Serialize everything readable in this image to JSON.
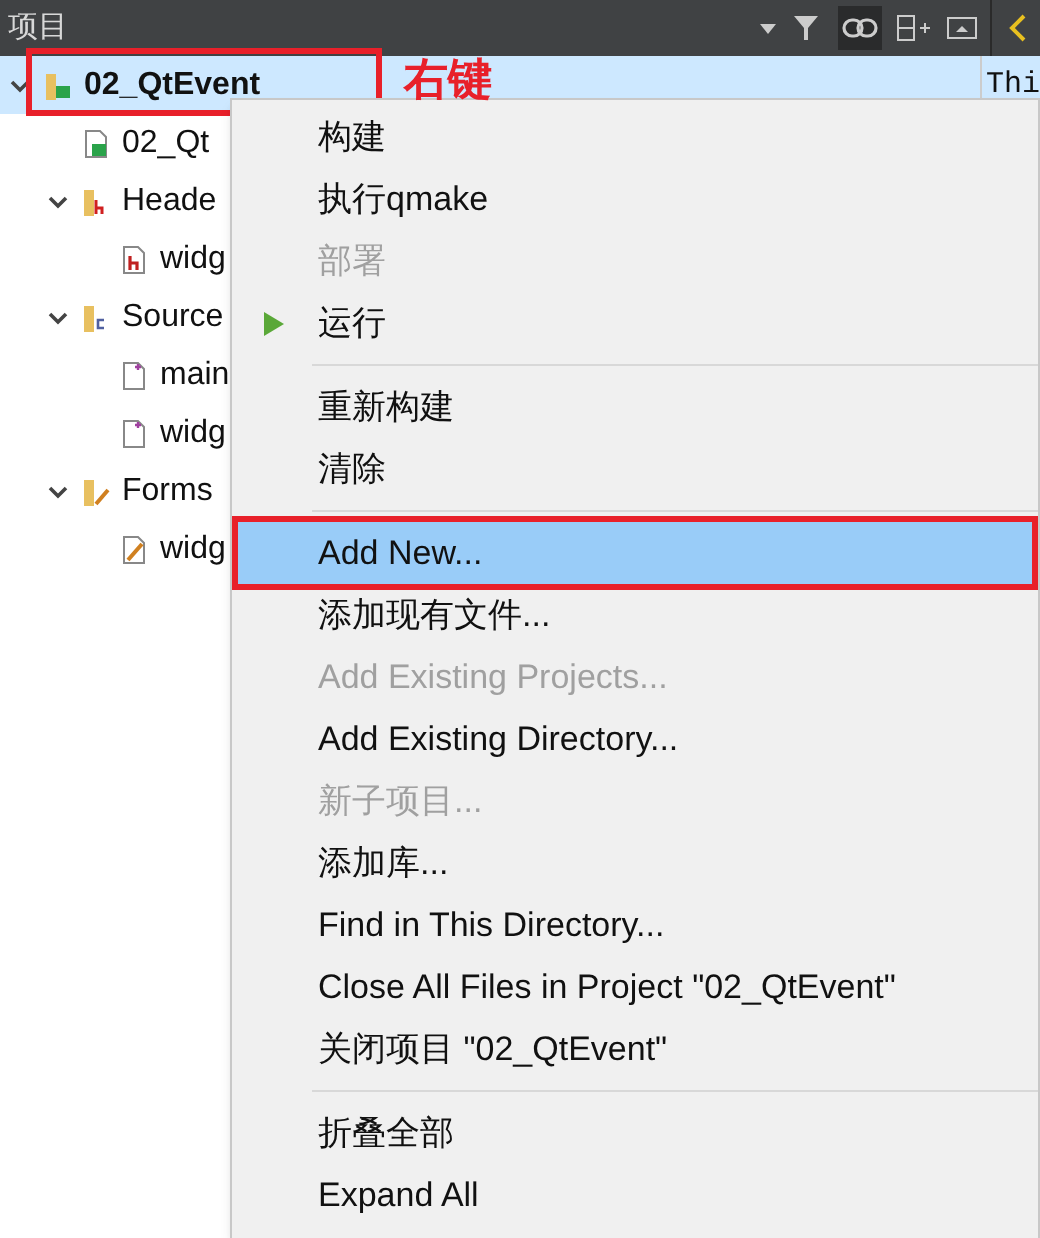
{
  "panel": {
    "title": "项目"
  },
  "tree": [
    {
      "label": "02_QtEvent",
      "kind": "project",
      "selected": true,
      "expanded": true,
      "children": [
        {
          "label": "02_Qt",
          "kind": "profile"
        },
        {
          "label": "Heade",
          "kind": "header-folder",
          "expanded": true,
          "children": [
            {
              "label": "widg",
              "kind": "header"
            }
          ]
        },
        {
          "label": "Source",
          "kind": "source-folder",
          "expanded": true,
          "children": [
            {
              "label": "main",
              "kind": "source"
            },
            {
              "label": "widg",
              "kind": "source"
            }
          ]
        },
        {
          "label": "Forms",
          "kind": "form-folder",
          "expanded": true,
          "children": [
            {
              "label": "widg",
              "kind": "form"
            }
          ]
        }
      ]
    }
  ],
  "editor": {
    "text": "Thi"
  },
  "annotation": {
    "text": "右键"
  },
  "context_menu": [
    {
      "kind": "item",
      "label": "构建",
      "disabled": false,
      "selected": false
    },
    {
      "kind": "item",
      "label": "执行qmake",
      "disabled": false,
      "selected": false
    },
    {
      "kind": "item",
      "label": "部署",
      "disabled": true,
      "selected": false
    },
    {
      "kind": "run",
      "label": "运行",
      "disabled": false,
      "selected": false
    },
    {
      "kind": "separator"
    },
    {
      "kind": "item",
      "label": "重新构建",
      "disabled": false,
      "selected": false
    },
    {
      "kind": "item",
      "label": "清除",
      "disabled": false,
      "selected": false
    },
    {
      "kind": "separator"
    },
    {
      "kind": "item",
      "label": "Add New...",
      "disabled": false,
      "selected": true,
      "outlined": true
    },
    {
      "kind": "item",
      "label": "添加现有文件...",
      "disabled": false,
      "selected": false
    },
    {
      "kind": "item",
      "label": "Add Existing Projects...",
      "disabled": true,
      "selected": false
    },
    {
      "kind": "item",
      "label": "Add Existing Directory...",
      "disabled": false,
      "selected": false
    },
    {
      "kind": "item",
      "label": "新子项目...",
      "disabled": true,
      "selected": false
    },
    {
      "kind": "item",
      "label": "添加库...",
      "disabled": false,
      "selected": false
    },
    {
      "kind": "item",
      "label": "Find in This Directory...",
      "disabled": false,
      "selected": false
    },
    {
      "kind": "item",
      "label": "Close All Files in Project \"02_QtEvent\"",
      "disabled": false,
      "selected": false
    },
    {
      "kind": "item",
      "label": "关闭项目 \"02_QtEvent\"",
      "disabled": false,
      "selected": false
    },
    {
      "kind": "separator"
    },
    {
      "kind": "item",
      "label": "折叠全部",
      "disabled": false,
      "selected": false
    },
    {
      "kind": "item",
      "label": "Expand All",
      "disabled": false,
      "selected": false
    }
  ]
}
